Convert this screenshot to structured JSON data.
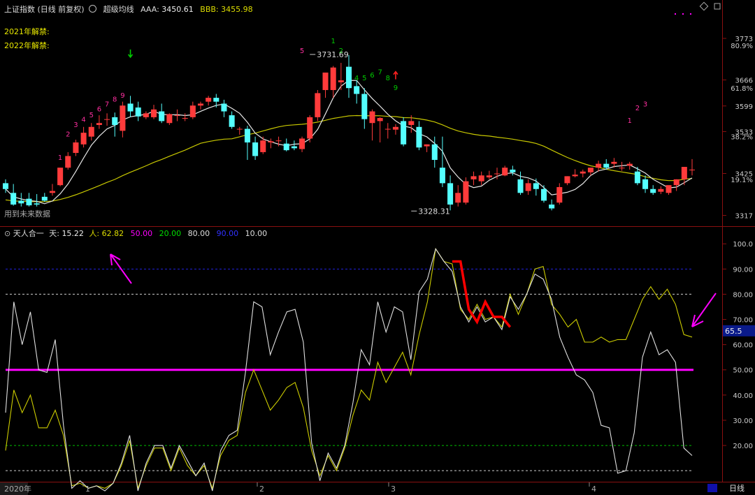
{
  "header": {
    "title": "上证指数 (日线 前复权)",
    "indicator": "超级均线",
    "aaa_label": "AAA:",
    "aaa_value": "3450.61",
    "bbb_label": "BBB:",
    "bbb_value": "3455.98"
  },
  "notes": [
    "2021年解禁:",
    "2022年解禁:"
  ],
  "future_note": "用到未来数据",
  "lower_header": {
    "name": "天人合一",
    "tian_label": "天:",
    "tian_value": "15.22",
    "ren_label": "人:",
    "ren_value": "62.82",
    "c1": "50.00",
    "c2": "20.00",
    "c3": "80.00",
    "c4": "90.00",
    "c5": "10.00"
  },
  "bottom_bar": {
    "date_start": "2020年",
    "months": [
      "1",
      "2",
      "3",
      "4"
    ],
    "period": "日线"
  },
  "colors": {
    "up": "#ff3b3b",
    "down": "#54ffff",
    "ma_short": "#e6e6e6",
    "ma_long": "#c8c800",
    "magenta": "#ff00ff",
    "osc_white": "#e0e0e0",
    "osc_yellow": "#cccc00",
    "highlight_red": "#ff0000"
  },
  "chart_data": [
    {
      "type": "candlestick",
      "y_ticks": [
        "3773",
        "3666",
        "3599",
        "3533",
        "3425",
        "3317"
      ],
      "pct_labels": [
        "80.9%",
        "61.8%",
        "38.2%",
        "19.1%"
      ],
      "ylim": [
        3300,
        3800
      ],
      "candles": [
        [
          3400,
          3410,
          3385,
          3375
        ],
        [
          3375,
          3398,
          3345,
          3342
        ],
        [
          3355,
          3375,
          3348,
          3340
        ],
        [
          3360,
          3375,
          3343,
          3340
        ],
        [
          3348,
          3372,
          3345,
          3340
        ],
        [
          3365,
          3375,
          3355,
          3352
        ],
        [
          3375,
          3398,
          3380,
          3368
        ],
        [
          3395,
          3440,
          3440,
          3392
        ],
        [
          3440,
          3480,
          3470,
          3435
        ],
        [
          3478,
          3512,
          3505,
          3470
        ],
        [
          3500,
          3545,
          3530,
          3492
        ],
        [
          3520,
          3555,
          3545,
          3510
        ],
        [
          3550,
          3575,
          3555,
          3540
        ],
        [
          3565,
          3580,
          3565,
          3548
        ],
        [
          3570,
          3582,
          3550,
          3520
        ],
        [
          3535,
          3610,
          3600,
          3518
        ],
        [
          3605,
          3625,
          3585,
          3570
        ],
        [
          3595,
          3610,
          3572,
          3560
        ],
        [
          3570,
          3585,
          3580,
          3565
        ],
        [
          3570,
          3602,
          3590,
          3565
        ],
        [
          3585,
          3605,
          3560,
          3555
        ],
        [
          3555,
          3580,
          3578,
          3550
        ],
        [
          3575,
          3590,
          3575,
          3560
        ],
        [
          3568,
          3580,
          3568,
          3560
        ],
        [
          3570,
          3610,
          3600,
          3565
        ],
        [
          3600,
          3610,
          3605,
          3590
        ],
        [
          3610,
          3625,
          3620,
          3600
        ],
        [
          3620,
          3630,
          3610,
          3595
        ],
        [
          3605,
          3615,
          3585,
          3570
        ],
        [
          3575,
          3585,
          3545,
          3540
        ],
        [
          3540,
          3545,
          3540,
          3525
        ],
        [
          3540,
          3548,
          3505,
          3460
        ],
        [
          3505,
          3520,
          3470,
          3460
        ],
        [
          3480,
          3520,
          3510,
          3475
        ],
        [
          3505,
          3515,
          3508,
          3490
        ],
        [
          3510,
          3520,
          3510,
          3495
        ],
        [
          3502,
          3515,
          3485,
          3482
        ],
        [
          3495,
          3510,
          3490,
          3485
        ],
        [
          3488,
          3520,
          3515,
          3480
        ],
        [
          3515,
          3575,
          3570,
          3505
        ],
        [
          3570,
          3640,
          3632,
          3560
        ],
        [
          3640,
          3680,
          3685,
          3620
        ],
        [
          3640,
          3702,
          3698,
          3620
        ],
        [
          3660,
          3710,
          3665,
          3640
        ],
        [
          3700,
          3730,
          3645,
          3620
        ],
        [
          3650,
          3665,
          3630,
          3605
        ],
        [
          3630,
          3645,
          3565,
          3540
        ],
        [
          3555,
          3590,
          3585,
          3510
        ],
        [
          3560,
          3570,
          3568,
          3505
        ],
        [
          3540,
          3555,
          3540,
          3515
        ],
        [
          3538,
          3552,
          3545,
          3525
        ],
        [
          3560,
          3570,
          3500,
          3495
        ],
        [
          3550,
          3575,
          3560,
          3530
        ],
        [
          3545,
          3560,
          3492,
          3485
        ],
        [
          3495,
          3500,
          3500,
          3480
        ],
        [
          3500,
          3520,
          3460,
          3440
        ],
        [
          3440,
          3520,
          3400,
          3390
        ],
        [
          3400,
          3420,
          3345,
          3330
        ],
        [
          3350,
          3395,
          3375,
          3340
        ],
        [
          3350,
          3415,
          3405,
          3345
        ],
        [
          3410,
          3430,
          3418,
          3395
        ],
        [
          3405,
          3430,
          3420,
          3395
        ],
        [
          3415,
          3432,
          3420,
          3410
        ],
        [
          3425,
          3440,
          3425,
          3410
        ],
        [
          3420,
          3445,
          3440,
          3418
        ],
        [
          3435,
          3445,
          3428,
          3420
        ],
        [
          3410,
          3430,
          3375,
          3370
        ],
        [
          3380,
          3410,
          3400,
          3370
        ],
        [
          3400,
          3412,
          3385,
          3368
        ],
        [
          3385,
          3395,
          3355,
          3350
        ],
        [
          3345,
          3358,
          3335,
          3330
        ],
        [
          3350,
          3400,
          3390,
          3345
        ],
        [
          3400,
          3418,
          3418,
          3395
        ],
        [
          3418,
          3436,
          3422,
          3415
        ],
        [
          3425,
          3435,
          3430,
          3415
        ],
        [
          3428,
          3440,
          3440,
          3420
        ],
        [
          3440,
          3458,
          3450,
          3430
        ],
        [
          3450,
          3462,
          3440,
          3435
        ],
        [
          3450,
          3465,
          3455,
          3440
        ],
        [
          3440,
          3455,
          3440,
          3432
        ],
        [
          3445,
          3455,
          3450,
          3435
        ],
        [
          3430,
          3442,
          3400,
          3395
        ],
        [
          3410,
          3420,
          3385,
          3375
        ],
        [
          3385,
          3395,
          3375,
          3370
        ],
        [
          3378,
          3392,
          3385,
          3372
        ],
        [
          3375,
          3390,
          3395,
          3370
        ],
        [
          3395,
          3410,
          3410,
          3380
        ],
        [
          3410,
          3442,
          3442,
          3395
        ],
        [
          3435,
          3462,
          3435,
          3420
        ]
      ],
      "td_counts": [
        {
          "text": "1",
          "color": "#ff2fa0",
          "i": 7,
          "v": 3460
        },
        {
          "text": "2",
          "color": "#ff2fa0",
          "i": 8,
          "v": 3520
        },
        {
          "text": "3",
          "color": "#ff2fa0",
          "i": 9,
          "v": 3545
        },
        {
          "text": "4",
          "color": "#ff2fa0",
          "i": 10,
          "v": 3558
        },
        {
          "text": "5",
          "color": "#ff2fa0",
          "i": 11,
          "v": 3570
        },
        {
          "text": "6",
          "color": "#ff2fa0",
          "i": 12,
          "v": 3585
        },
        {
          "text": "7",
          "color": "#ff2fa0",
          "i": 13,
          "v": 3598
        },
        {
          "text": "8",
          "color": "#ff2fa0",
          "i": 14,
          "v": 3610
        },
        {
          "text": "9",
          "color": "#ff2fa0",
          "i": 15,
          "v": 3620
        },
        {
          "text": "5",
          "color": "#ff2fa0",
          "i": 38,
          "v": 3735
        },
        {
          "text": "1",
          "color": "#00cc00",
          "i": 42,
          "v": 3760
        },
        {
          "text": "2",
          "color": "#00cc00",
          "i": 43,
          "v": 3735
        },
        {
          "text": "4",
          "color": "#00cc00",
          "i": 45,
          "v": 3665
        },
        {
          "text": "5",
          "color": "#00cc00",
          "i": 46,
          "v": 3665
        },
        {
          "text": "6",
          "color": "#00cc00",
          "i": 47,
          "v": 3672
        },
        {
          "text": "7",
          "color": "#00cc00",
          "i": 48,
          "v": 3680
        },
        {
          "text": "8",
          "color": "#00cc00",
          "i": 49,
          "v": 3665
        },
        {
          "text": "9",
          "color": "#00cc00",
          "i": 50,
          "v": 3640
        },
        {
          "text": "1",
          "color": "#ff2fa0",
          "i": 80,
          "v": 3555
        },
        {
          "text": "2",
          "color": "#ff2fa0",
          "i": 81,
          "v": 3588
        },
        {
          "text": "3",
          "color": "#ff2fa0",
          "i": 82,
          "v": 3598
        }
      ],
      "arrows": [
        {
          "dir": "down",
          "color": "#00cc00",
          "i": 16,
          "v": 3730
        },
        {
          "dir": "up",
          "color": "#ff2020",
          "i": 50,
          "v": 3682
        }
      ],
      "price_labels": [
        {
          "text": "3731.69",
          "i": 39,
          "v": 3731.69
        },
        {
          "text": "3328.31",
          "i": 52,
          "v": 3328.31
        }
      ]
    },
    {
      "type": "line",
      "y_ticks": [
        "100.0",
        "90.00",
        "80.00",
        "70.00",
        "60.00",
        "50.00",
        "40.00",
        "30.00",
        "20.00"
      ],
      "ylim": [
        7,
        102
      ],
      "value_tag": "65.5",
      "ref_lines": [
        90,
        80,
        50,
        20,
        10
      ],
      "series": [
        {
          "color": "white",
          "values": [
            33,
            77,
            60,
            73,
            50,
            49,
            62,
            28,
            3,
            6,
            3,
            4,
            2,
            5,
            13,
            24,
            2,
            13,
            20,
            20,
            11,
            20,
            14,
            8,
            13,
            2,
            18,
            24,
            26,
            49,
            77,
            75,
            56,
            65,
            73,
            74,
            61,
            21,
            6,
            17,
            11,
            20,
            37,
            58,
            52,
            77,
            65,
            75,
            73,
            54,
            81,
            86,
            98,
            93,
            89,
            75,
            69,
            75,
            69,
            71,
            66,
            79,
            74,
            80,
            88,
            86,
            78,
            63,
            55,
            48,
            46,
            41,
            28,
            27,
            9,
            10,
            25,
            55,
            65,
            56,
            58,
            53,
            19,
            16
          ]
        },
        {
          "color": "yellow",
          "values": [
            18,
            42,
            33,
            40,
            27,
            27,
            34,
            24,
            4,
            5,
            3,
            4,
            3,
            5,
            12,
            22,
            3,
            12,
            19,
            19,
            10,
            19,
            12,
            8,
            12,
            3,
            16,
            22,
            24,
            41,
            50,
            42,
            34,
            38,
            43,
            45,
            35,
            18,
            8,
            16,
            10,
            19,
            32,
            42,
            38,
            53,
            45,
            51,
            57,
            48,
            64,
            77,
            98,
            93,
            92,
            74,
            70,
            76,
            70,
            71,
            67,
            80,
            72,
            80,
            90,
            91,
            76,
            72,
            67,
            70,
            61,
            61,
            63,
            61,
            62,
            62,
            70,
            78,
            83,
            78,
            82,
            76,
            64,
            63
          ]
        }
      ],
      "red_segment": [
        [
          54,
          93
        ],
        [
          55,
          93
        ],
        [
          56,
          74
        ],
        [
          57,
          69
        ],
        [
          58,
          77
        ],
        [
          59,
          71
        ],
        [
          60,
          71
        ],
        [
          61,
          67
        ]
      ]
    }
  ]
}
